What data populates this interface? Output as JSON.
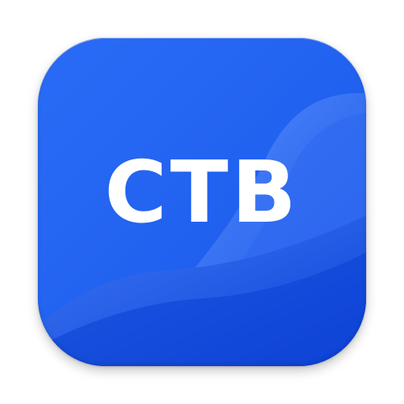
{
  "app_icon": {
    "label": "CTB",
    "colors": {
      "base": "#1f63f2",
      "wave_light": "#4d86f7",
      "wave_dark": "#0f46dc",
      "text": "#ffffff"
    }
  }
}
